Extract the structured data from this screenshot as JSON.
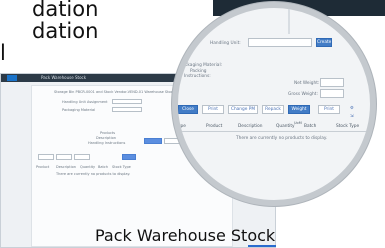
{
  "slide_text": {
    "line1": "dation",
    "line2": "l",
    "line3": "l"
  },
  "caption": "Pack Warehouse Stock",
  "app": {
    "title": "Pack Warehouse Stock",
    "header_text": "Storage Bin PBCR-0001 and Stock Vendor-VEND-01 Warehouse Stock",
    "field_labels": [
      "Handling Unit Assignment",
      "Packaging Material"
    ],
    "side_labels": [
      "Products",
      "Description",
      "Handling Instructions"
    ],
    "toolbar": [
      "Close HU",
      "Print",
      "Create HU",
      "Repack",
      "Weight",
      "Print"
    ],
    "list_headers": [
      "Product",
      "Description",
      "Quantity",
      "Batch",
      "Stock Type"
    ],
    "empty_text": "There are currently no products to display."
  },
  "magnifier": {
    "handling_unit_label": "Handling Unit:",
    "create_button": "Create",
    "packaging_material_label": "Packaging Material:",
    "packing_instructions_label": "Packing Instructions:",
    "packaging_material_value": "",
    "packing_instructions_value": "",
    "net_weight_label": "Net Weight:",
    "gross_weight_label": "Gross Weight:",
    "toolbar": {
      "close": "Close",
      "print": "Print",
      "change_pm": "Change PM",
      "repack": "Repack",
      "weight": "Weight",
      "print2": "Print"
    },
    "table": {
      "headers": [
        "Product",
        "Description",
        "Quantity",
        "UoM",
        "Batch",
        "Stock Type"
      ],
      "empty": "There are currently no products to display."
    },
    "side_partial": "ype"
  }
}
